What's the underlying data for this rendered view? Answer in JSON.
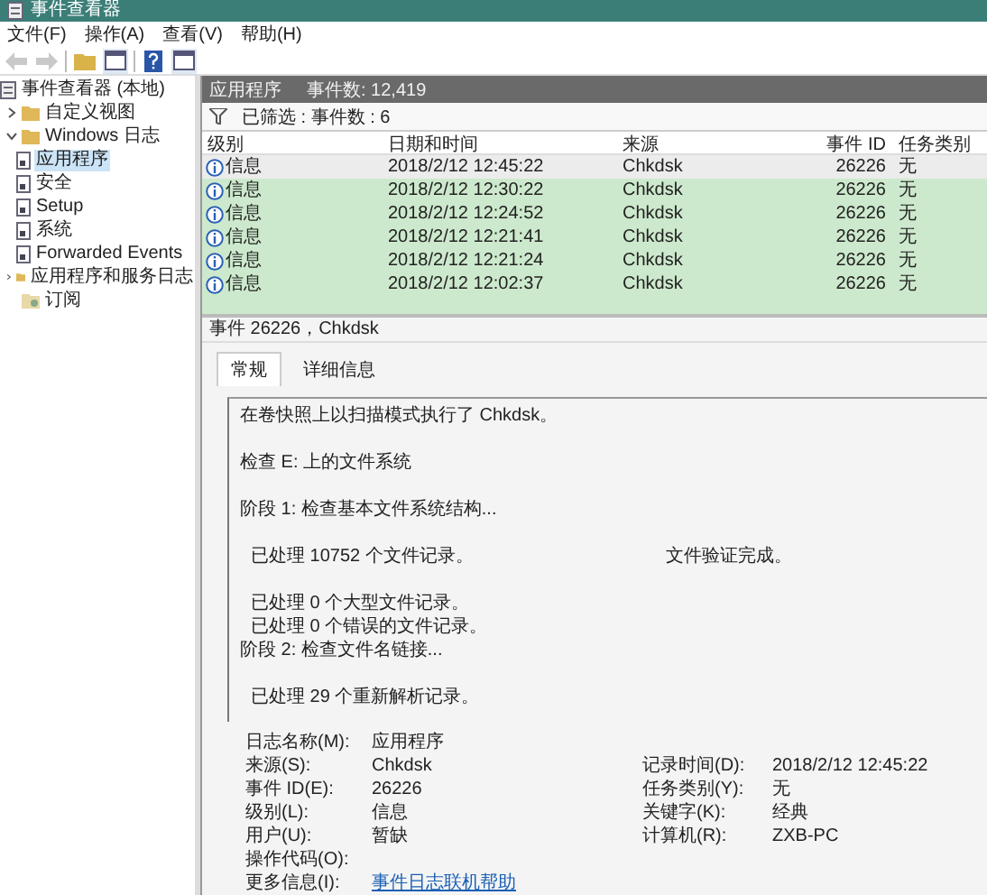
{
  "window": {
    "title": "事件查看器"
  },
  "menu": [
    "文件(F)",
    "操作(A)",
    "查看(V)",
    "帮助(H)"
  ],
  "toolbar": [
    {
      "kind": "back",
      "disabled": true
    },
    {
      "kind": "forward",
      "disabled": true
    },
    {
      "kind": "folder",
      "disabled": false
    },
    {
      "kind": "panel",
      "disabled": false
    },
    {
      "kind": "help",
      "disabled": false
    },
    {
      "kind": "panel",
      "disabled": false
    }
  ],
  "tree": [
    {
      "label": "事件查看器 (本地)",
      "selected": false,
      "children": [
        {
          "label": "自定义视图",
          "expanded": false,
          "selected": false
        },
        {
          "label": "Windows 日志",
          "expanded": true,
          "selected": false,
          "children": [
            {
              "label": "应用程序",
              "selected": true
            },
            {
              "label": "安全",
              "selected": false
            },
            {
              "label": "Setup",
              "selected": false
            },
            {
              "label": "系统",
              "selected": false
            },
            {
              "label": "Forwarded Events",
              "selected": false
            }
          ]
        },
        {
          "label": "应用程序和服务日志",
          "expanded": false,
          "selected": false
        },
        {
          "label": "订阅",
          "selected": false
        }
      ]
    }
  ],
  "header": {
    "title": "应用程序",
    "count": "事件数: 12,419"
  },
  "filter": {
    "text": "已筛选 : 事件数 : 6"
  },
  "table": {
    "columns": [
      "级别",
      "日期和时间",
      "来源",
      "事件 ID",
      "任务类别"
    ],
    "rows": [
      {
        "level": "信息",
        "time": "2018/2/12 12:45:22",
        "source": "Chkdsk",
        "id": "26226",
        "task": "无",
        "selected": true
      },
      {
        "level": "信息",
        "time": "2018/2/12 12:30:22",
        "source": "Chkdsk",
        "id": "26226",
        "task": "无",
        "selected": false
      },
      {
        "level": "信息",
        "time": "2018/2/12 12:24:52",
        "source": "Chkdsk",
        "id": "26226",
        "task": "无",
        "selected": false
      },
      {
        "level": "信息",
        "time": "2018/2/12 12:21:41",
        "source": "Chkdsk",
        "id": "26226",
        "task": "无",
        "selected": false
      },
      {
        "level": "信息",
        "time": "2018/2/12 12:21:24",
        "source": "Chkdsk",
        "id": "26226",
        "task": "无",
        "selected": false
      },
      {
        "level": "信息",
        "time": "2018/2/12 12:02:37",
        "source": "Chkdsk",
        "id": "26226",
        "task": "无",
        "selected": false
      }
    ]
  },
  "event": {
    "title": "事件 26226，Chkdsk",
    "tabs": [
      {
        "label": "常规",
        "selected": true
      },
      {
        "label": "详细信息",
        "selected": false
      }
    ],
    "message": [
      [
        {
          "kind": "step",
          "text": "在卷快照上以扫描模式执行了 Chkdsk。"
        }
      ],
      [
        {
          "kind": "step",
          "text": "检查 E: 上的文件系统"
        }
      ],
      [
        {
          "kind": "step",
          "text": "阶段 1: 检查基本文件系统结构..."
        }
      ],
      [
        {
          "kind": "detail",
          "text": "已处理 10752 个文件记录。",
          "note": "文件验证完成。"
        }
      ],
      [
        {
          "kind": "detail",
          "text": "已处理 0 个大型文件记录。"
        },
        {
          "kind": "detail",
          "text": "已处理 0 个错误的文件记录。"
        },
        {
          "kind": "step",
          "text": "阶段 2: 检查文件名链接..."
        }
      ],
      [
        {
          "kind": "detail",
          "text": "已处理 29 个重新解析记录。"
        }
      ]
    ],
    "details": [
      [
        {
          "label": "日志名称(M):",
          "value": "应用程序"
        }
      ],
      [
        {
          "label": "来源(S):",
          "value": "Chkdsk"
        },
        {
          "label": "记录时间(D):",
          "value": "2018/2/12 12:45:22"
        }
      ],
      [
        {
          "label": "事件 ID(E):",
          "value": "26226"
        },
        {
          "label": "任务类别(Y):",
          "value": "无"
        }
      ],
      [
        {
          "label": "级别(L):",
          "value": "信息"
        },
        {
          "label": "关键字(K):",
          "value": "经典"
        }
      ],
      [
        {
          "label": "用户(U):",
          "value": "暂缺"
        },
        {
          "label": "计算机(R):",
          "value": "ZXB-PC"
        }
      ],
      [
        {
          "label": "操作代码(O):"
        }
      ],
      [
        {
          "label": "更多信息(I):",
          "value": "事件日志联机帮助",
          "kind": "link"
        }
      ]
    ]
  }
}
